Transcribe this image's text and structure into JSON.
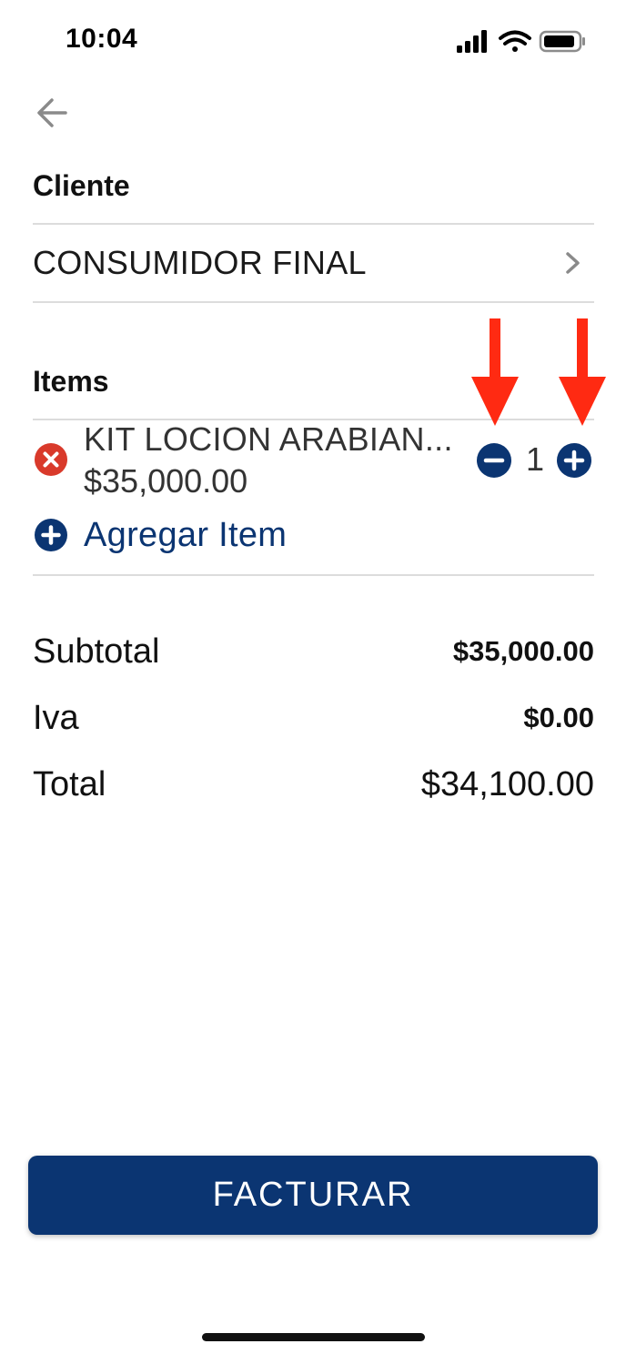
{
  "status_bar": {
    "time": "10:04"
  },
  "header": {
    "back_icon": "arrow-left-icon"
  },
  "client_section": {
    "label": "Cliente",
    "selected_client": "CONSUMIDOR FINAL",
    "chevron_icon": "chevron-right-icon"
  },
  "items_section": {
    "label": "Items",
    "items": [
      {
        "name": "KIT LOCION ARABIAN...",
        "price": "$35,000.00",
        "quantity": "1"
      }
    ],
    "add_item_label": "Agregar Item"
  },
  "summary": {
    "subtotal_label": "Subtotal",
    "subtotal_value": "$35,000.00",
    "iva_label": "Iva",
    "iva_value": "$0.00",
    "total_label": "Total",
    "total_value": "$34,100.00"
  },
  "actions": {
    "submit_label": "FACTURAR"
  },
  "colors": {
    "primary": "#0b3572",
    "remove": "#d93a2b",
    "annotation_arrow": "#ff2a12",
    "divider": "#dcdcdc"
  }
}
